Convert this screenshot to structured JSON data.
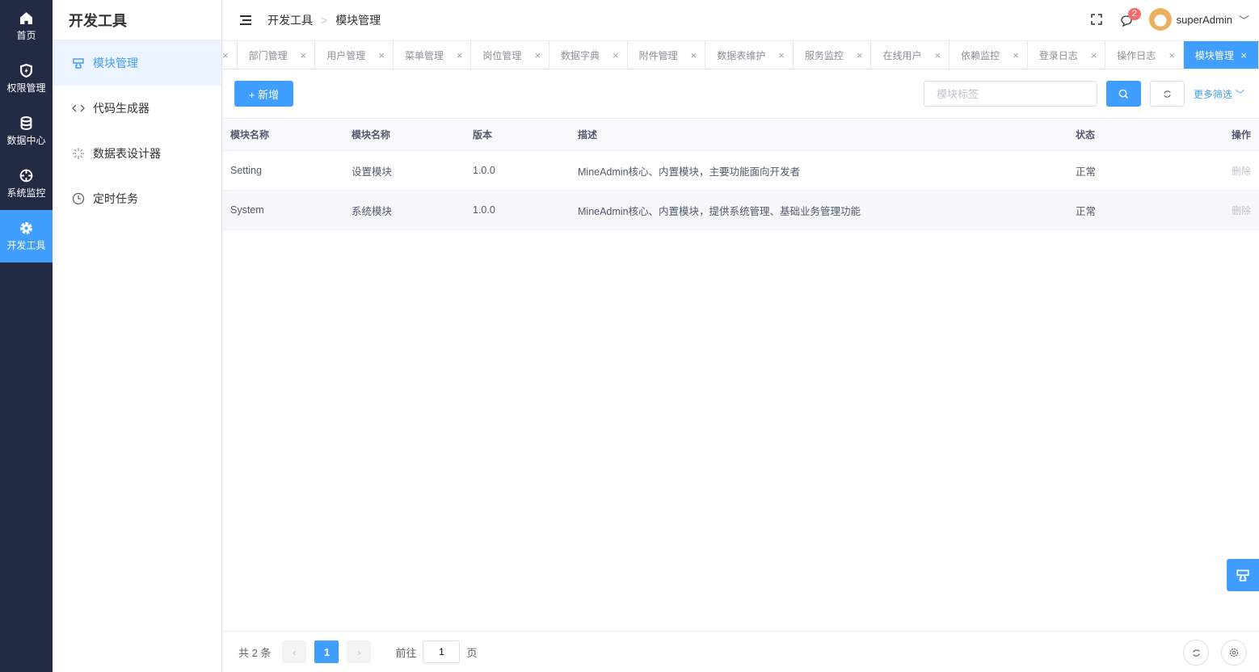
{
  "rail": [
    {
      "label": "首页",
      "icon": "home-icon"
    },
    {
      "label": "权限管理",
      "icon": "shield-icon"
    },
    {
      "label": "数据中心",
      "icon": "database-icon"
    },
    {
      "label": "系统监控",
      "icon": "crosshair-icon"
    },
    {
      "label": "开发工具",
      "icon": "gear-icon"
    }
  ],
  "sidebar": {
    "title": "开发工具",
    "items": [
      {
        "label": "模块管理"
      },
      {
        "label": "代码生成器"
      },
      {
        "label": "数据表设计器"
      },
      {
        "label": "定时任务"
      }
    ]
  },
  "breadcrumb": [
    "开发工具",
    "模块管理"
  ],
  "header": {
    "badge": "2",
    "user": "superAdmin"
  },
  "tabs": [
    "部门管理",
    "用户管理",
    "菜单管理",
    "岗位管理",
    "数据字典",
    "附件管理",
    "数据表维护",
    "服务监控",
    "在线用户",
    "依赖监控",
    "登录日志",
    "操作日志",
    "模块管理"
  ],
  "toolbar": {
    "add": "+ 新增",
    "search_placeholder": "模块标签",
    "more": "更多筛选"
  },
  "table": {
    "headers": [
      "模块名称",
      "模块名称",
      "版本",
      "描述",
      "状态",
      "操作"
    ],
    "rows": [
      [
        "Setting",
        "设置模块",
        "1.0.0",
        "MineAdmin核心、内置模块，主要功能面向开发者",
        "正常",
        "删除"
      ],
      [
        "System",
        "系统模块",
        "1.0.0",
        "MineAdmin核心、内置模块，提供系统管理、基础业务管理功能",
        "正常",
        "删除"
      ]
    ]
  },
  "pager": {
    "total": "共 2 条",
    "page": "1",
    "goto": "前往",
    "goto_value": "1",
    "page_suffix": "页"
  },
  "colors": {
    "accent": "#409eff",
    "rail": "#222a44"
  }
}
